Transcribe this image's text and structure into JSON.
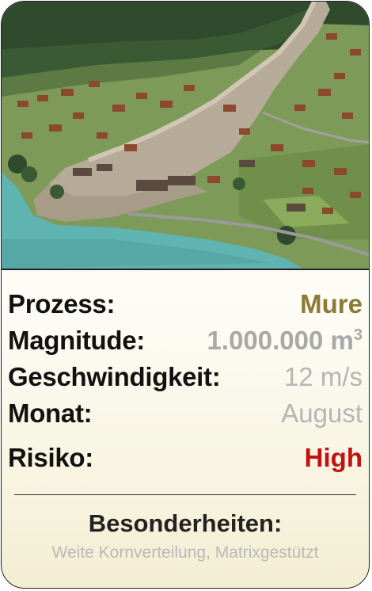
{
  "card": {
    "rows": [
      {
        "label": "Prozess:",
        "value": "Mure"
      },
      {
        "label": "Magnitude:",
        "value": "1.000.000 m",
        "value_sup": "3"
      },
      {
        "label": "Geschwindigkeit:",
        "value": "12 m/s"
      },
      {
        "label": "Monat:",
        "value": "August"
      },
      {
        "label": "Risiko:",
        "value": "High"
      }
    ],
    "section_title": "Besonderheiten:",
    "section_text": "Weite Kornverteilung, Matrixgestützt"
  },
  "colors": {
    "process_value": "#8c7a35",
    "magnitude_value": "#a8a8a8",
    "secondary_value": "#b5b5b5",
    "risk_value": "#c41010",
    "lake": "#5fb3b0",
    "forest": "#2f4a2c",
    "debris": "#b5ab98"
  },
  "photo": {
    "subject": "aerial-view-debris-flow-village"
  }
}
